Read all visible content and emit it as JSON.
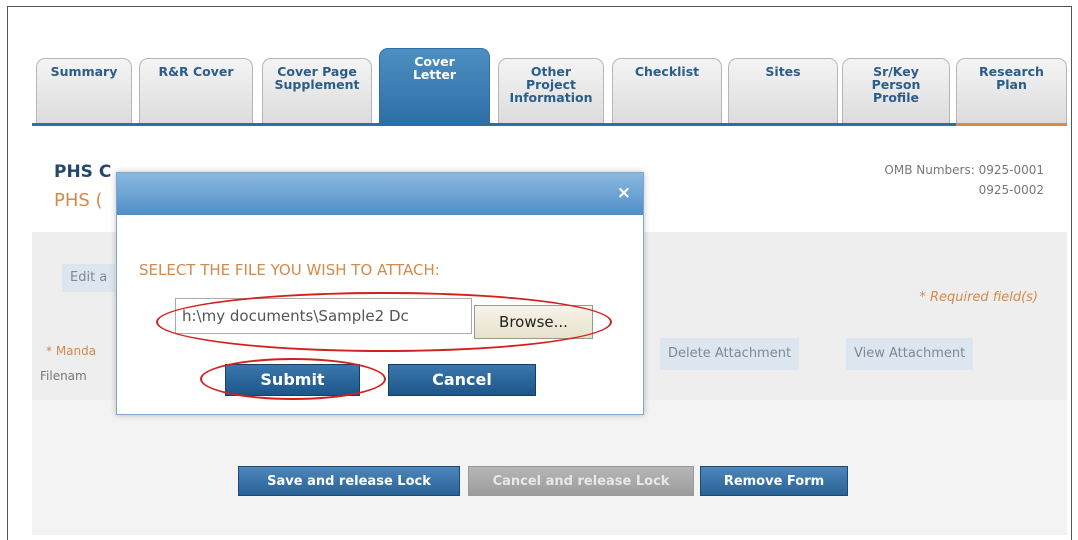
{
  "tabs": [
    {
      "label": "Summary",
      "active": false
    },
    {
      "label": "R&R Cover",
      "active": false
    },
    {
      "label": "Cover Page\nSupplement",
      "active": false
    },
    {
      "label": "Cover\nLetter",
      "active": true
    },
    {
      "label": "Other\nProject\nInformation",
      "active": false
    },
    {
      "label": "Checklist",
      "active": false
    },
    {
      "label": "Sites",
      "active": false
    },
    {
      "label": "Sr/Key\nPerson\nProfile",
      "active": false
    },
    {
      "label": "Research\nPlan",
      "active": false
    }
  ],
  "page": {
    "heading_visible": "PHS C",
    "subheading_visible": "PHS (",
    "omb_label": "OMB Numbers: 0925-0001",
    "omb_second": "0925-0002",
    "edit_visible": "Edit a",
    "required_note": "* Required field(s)",
    "mandatory_visible": "* Manda",
    "filename_visible": "Filenam",
    "delete_attachment": "Delete Attachment",
    "view_attachment": "View Attachment"
  },
  "bottom_buttons": {
    "save": "Save and release Lock",
    "cancel": "Cancel and release Lock",
    "remove": "Remove Form"
  },
  "dialog": {
    "close_glyph": "×",
    "title": "SELECT THE FILE YOU WISH TO ATTACH:",
    "file_value": "h:\\my documents\\Sample2 Dc",
    "browse_label": "Browse...",
    "submit_label": "Submit",
    "cancel_label": "Cancel"
  },
  "colors": {
    "accent_blue": "#2e6ea6",
    "accent_orange": "#d5894a",
    "highlight_red": "#d22020"
  }
}
